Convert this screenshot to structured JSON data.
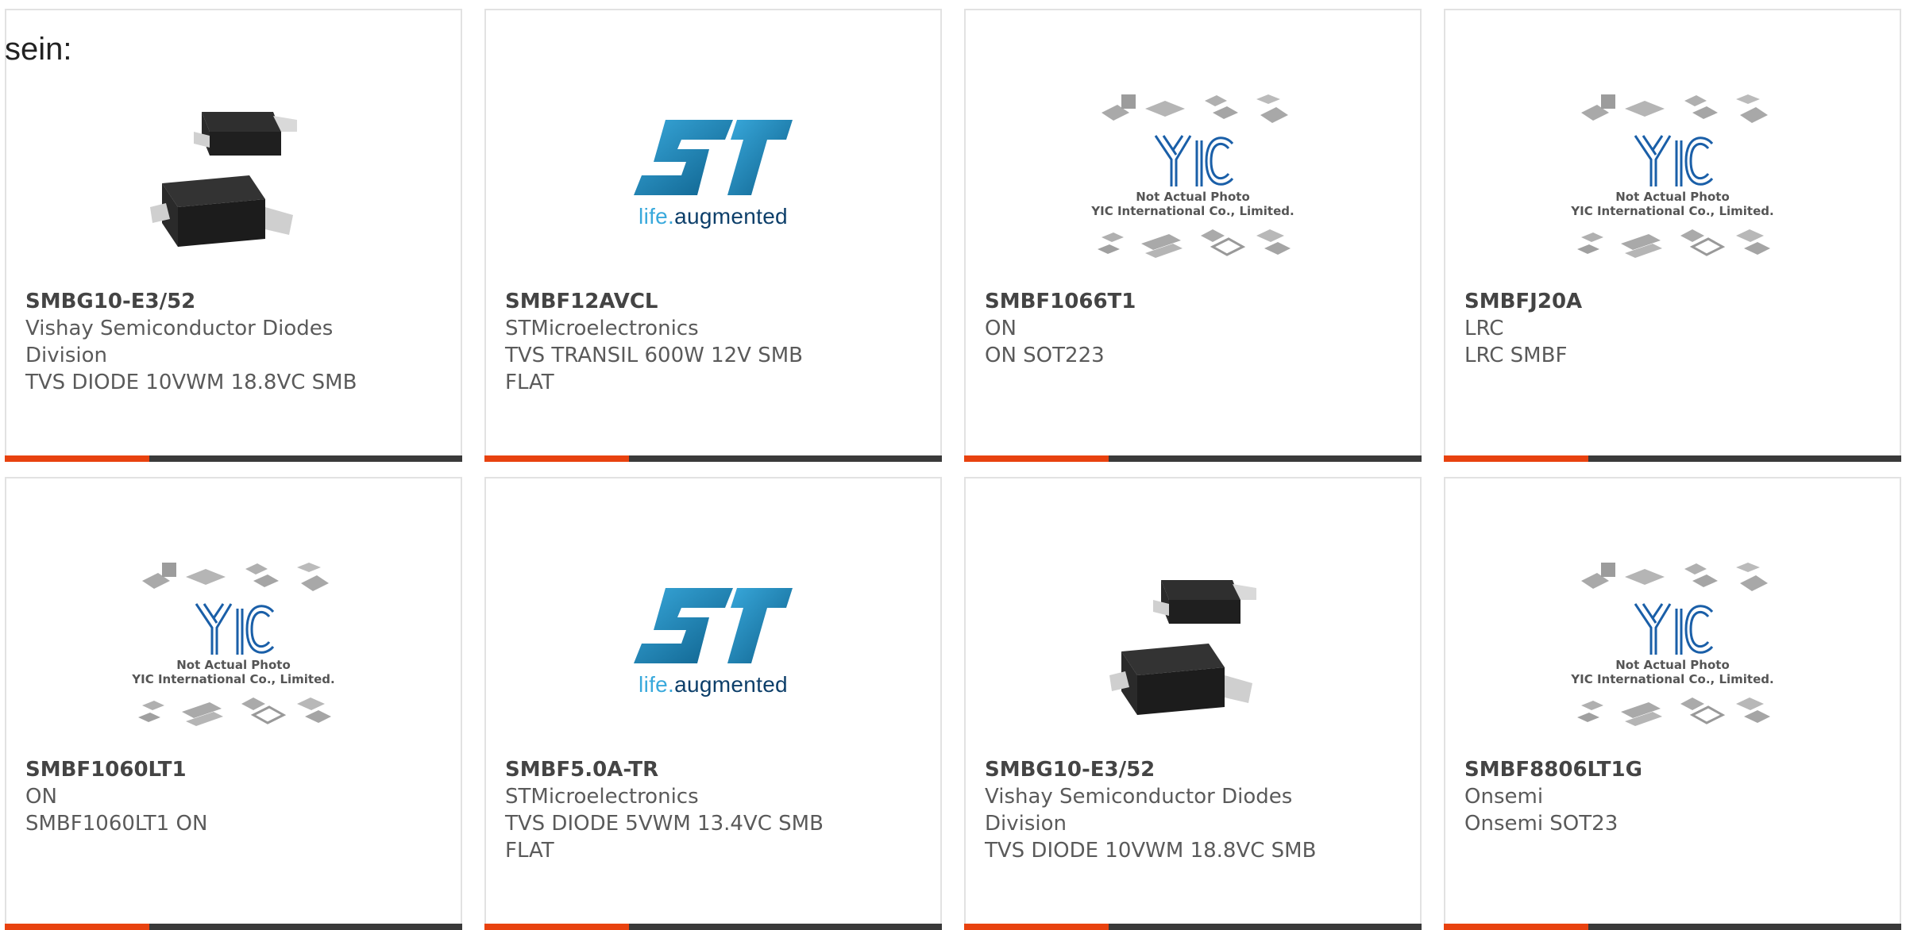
{
  "heading": "sein:",
  "colors": {
    "accent": "#e8420f",
    "bar": "#3a3a3a",
    "st_blue": "#1e8bc3",
    "yic_blue": "#1a5fa8"
  },
  "yic_logo": {
    "caption_line1": "Not Actual Photo",
    "caption_line2": "YIC International Co., Limited."
  },
  "st_logo": {
    "tagline_prefix": "life.",
    "tagline_suffix": "augmented"
  },
  "cards": [
    {
      "image": "package-photo",
      "part": "SMBG10-E3/52",
      "lines": [
        "Vishay Semiconductor Diodes",
        "Division",
        "TVS DIODE 10VWM 18.8VC SMB"
      ]
    },
    {
      "image": "st-logo",
      "part": "SMBF12AVCL",
      "lines": [
        "STMicroelectronics",
        "TVS TRANSIL 600W 12V SMB",
        "FLAT"
      ]
    },
    {
      "image": "yic-placeholder",
      "part": "SMBF1066T1",
      "lines": [
        "ON",
        "ON SOT223"
      ]
    },
    {
      "image": "yic-placeholder",
      "part": "SMBFJ20A",
      "lines": [
        "LRC",
        "LRC SMBF"
      ]
    },
    {
      "image": "yic-placeholder",
      "part": "SMBF1060LT1",
      "lines": [
        "ON",
        "SMBF1060LT1 ON"
      ]
    },
    {
      "image": "st-logo",
      "part": "SMBF5.0A-TR",
      "lines": [
        "STMicroelectronics",
        "TVS DIODE 5VWM 13.4VC SMB",
        "FLAT"
      ]
    },
    {
      "image": "package-photo",
      "part": "SMBG10-E3/52",
      "lines": [
        "Vishay Semiconductor Diodes",
        "Division",
        "TVS DIODE 10VWM 18.8VC SMB"
      ]
    },
    {
      "image": "yic-placeholder",
      "part": "SMBF8806LT1G",
      "lines": [
        "Onsemi",
        "Onsemi SOT23"
      ]
    }
  ]
}
